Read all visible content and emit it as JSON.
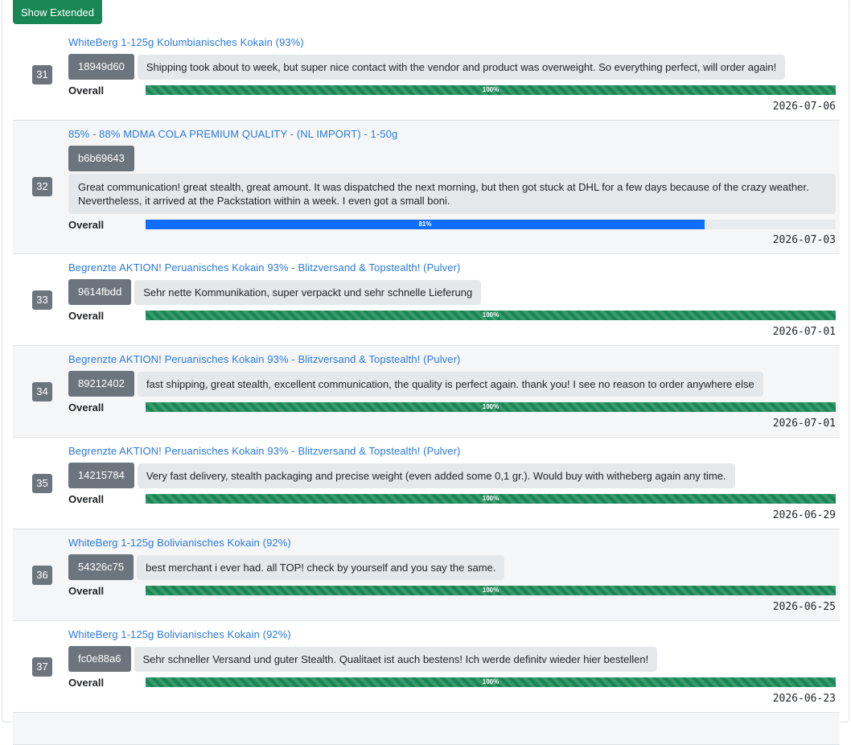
{
  "toolbar": {
    "show_extended_label": "Show Extended"
  },
  "overall_label": "Overall",
  "colors": {
    "accent_green": "#198754",
    "accent_blue": "#0d6efd",
    "link": "#2a7ae2",
    "badge_gray": "#6c757d"
  },
  "reviews": [
    {
      "num": "31",
      "title": "WhiteBerg 1-125g Kolumbianisches Kokain (93%)",
      "hash": "18949d60",
      "comment": "Shipping took about to week, but super nice contact with the vendor and product was overweight. So everything perfect, will order again!",
      "rating_pct": 100,
      "rating_label": "100%",
      "date": "2026-07-06"
    },
    {
      "num": "32",
      "title": "85% - 88% MDMA COLA PREMIUM QUALITY - (NL IMPORT) - 1-50g",
      "hash": "b6b69643",
      "comment": "Great communication! great stealth, great amount. It was dispatched the next morning, but then got stuck at DHL for a few days because of the crazy weather. Nevertheless, it arrived at the Packstation within a week. I even got a small boni.",
      "rating_pct": 81,
      "rating_label": "81%",
      "date": "2026-07-03"
    },
    {
      "num": "33",
      "title": "Begrenzte AKTION! Peruanisches Kokain 93% - Blitzversand & Topstealth! (Pulver)",
      "hash": "9614fbdd",
      "comment": "Sehr nette Kommunikation, super verpackt und sehr schnelle Lieferung",
      "rating_pct": 100,
      "rating_label": "100%",
      "date": "2026-07-01"
    },
    {
      "num": "34",
      "title": "Begrenzte AKTION! Peruanisches Kokain 93% - Blitzversand & Topstealth! (Pulver)",
      "hash": "89212402",
      "comment": "fast shipping, great stealth, excellent communication, the quality is perfect again. thank you! I see no reason to order anywhere else",
      "rating_pct": 100,
      "rating_label": "100%",
      "date": "2026-07-01"
    },
    {
      "num": "35",
      "title": "Begrenzte AKTION! Peruanisches Kokain 93% - Blitzversand & Topstealth! (Pulver)",
      "hash": "14215784",
      "comment": "Very fast delivery, stealth packaging and precise weight (even added some 0,1 gr.). Would buy with witheberg again any time.",
      "rating_pct": 100,
      "rating_label": "100%",
      "date": "2026-06-29"
    },
    {
      "num": "36",
      "title": "WhiteBerg 1-125g Bolivianisches Kokain (92%)",
      "hash": "54326c75",
      "comment": "best merchant i ever had. all TOP! check by yourself and you say the same.",
      "rating_pct": 100,
      "rating_label": "100%",
      "date": "2026-06-25"
    },
    {
      "num": "37",
      "title": "WhiteBerg 1-125g Bolivianisches Kokain (92%)",
      "hash": "fc0e88a6",
      "comment": "Sehr schneller Versand und guter Stealth. Qualitaet ist auch bestens! Ich werde definitv wieder hier bestellen!",
      "rating_pct": 100,
      "rating_label": "100%",
      "date": "2026-06-23"
    }
  ]
}
